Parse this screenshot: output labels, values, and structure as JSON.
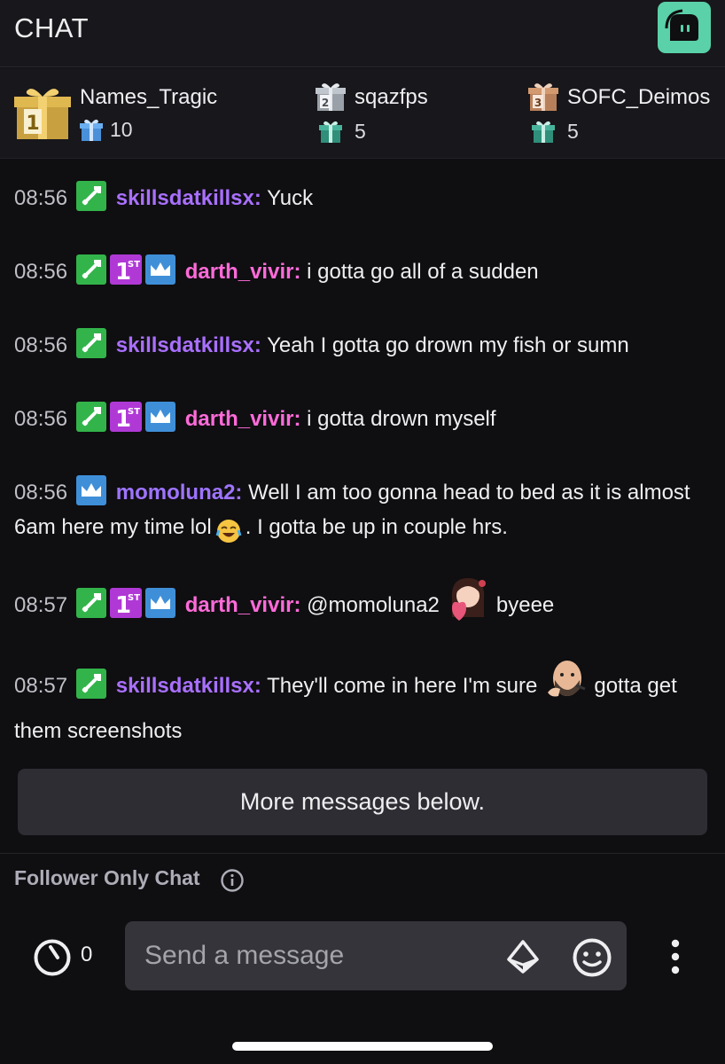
{
  "header": {
    "title": "CHAT"
  },
  "leaderboard": [
    {
      "rank": "1",
      "name": "Names_Tragic",
      "gifts": "10"
    },
    {
      "rank": "2",
      "name": "sqazfps",
      "gifts": "5"
    },
    {
      "rank": "3",
      "name": "SOFC_Deimos",
      "gifts": "5"
    }
  ],
  "messages": [
    {
      "time": "08:56",
      "user": "skillsdatkillsx:",
      "text": "Yuck"
    },
    {
      "time": "08:56",
      "user": "darth_vivir:",
      "text": "i gotta go all of a sudden"
    },
    {
      "time": "08:56",
      "user": "skillsdatkillsx:",
      "text": "Yeah I gotta go drown my fish or sumn"
    },
    {
      "time": "08:56",
      "user": "darth_vivir:",
      "text": "i gotta drown myself"
    },
    {
      "time": "08:56",
      "user": "momoluna2:",
      "text_a": "Well I am too gonna head to bed as it is almost 6am here my time lol",
      "text_b": ". I gotta be up in couple hrs."
    },
    {
      "time": "08:57",
      "user": "darth_vivir:",
      "text_a": "@momoluna2",
      "text_b": "byeee"
    },
    {
      "time": "08:57",
      "user": "skillsdatkillsx:",
      "text_a": "They'll come in here I'm sure",
      "text_b": "gotta get them screenshots"
    }
  ],
  "banner": {
    "more_messages": "More messages below."
  },
  "chat_mode": {
    "label": "Follower Only Chat"
  },
  "composer": {
    "points": "0",
    "placeholder": "Send a message"
  },
  "colors": {
    "accent_hype": "#5ad1a8",
    "user_skills": "#a970ff",
    "user_darth": "#ff6bd9",
    "user_momo": "#9e74ff"
  },
  "icons": [
    "gift-icon",
    "sword-badge-icon",
    "first-badge-icon",
    "crown-badge-icon",
    "laughing-emoji-icon",
    "info-icon",
    "channel-points-icon",
    "bits-icon",
    "emoji-icon",
    "more-vertical-icon"
  ]
}
